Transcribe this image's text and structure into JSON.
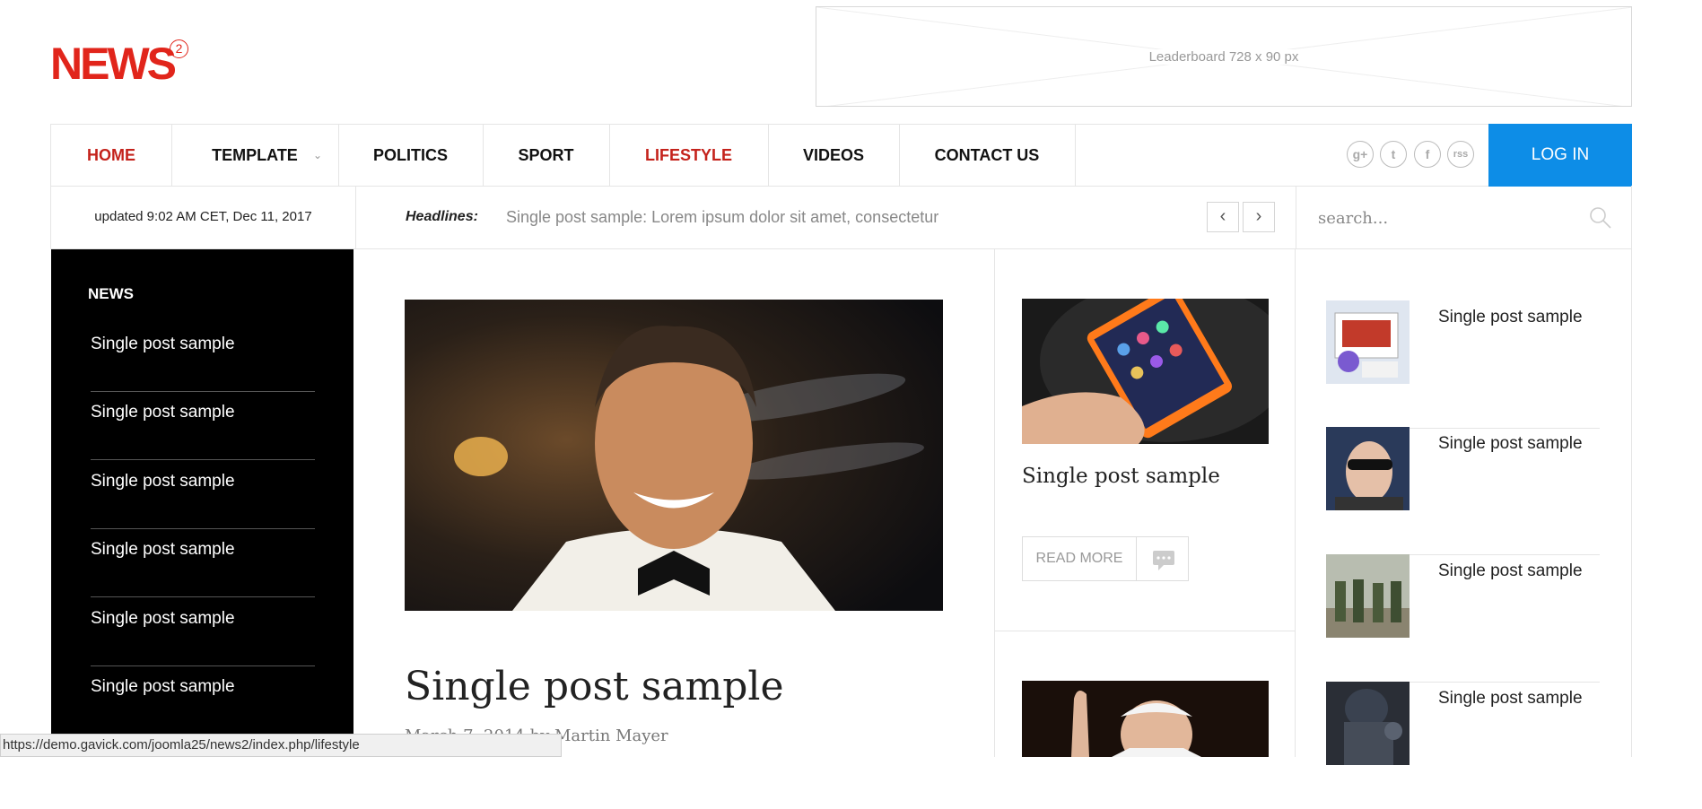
{
  "logo": {
    "text": "NEWS",
    "superscript": "2"
  },
  "leaderboard": {
    "label": "Leaderboard  728 x 90 px"
  },
  "nav": {
    "items": [
      {
        "label": "HOME"
      },
      {
        "label": "TEMPLATE"
      },
      {
        "label": "POLITICS"
      },
      {
        "label": "SPORT"
      },
      {
        "label": "LIFESTYLE"
      },
      {
        "label": "VIDEOS"
      },
      {
        "label": "CONTACT US"
      }
    ],
    "social": [
      "g+",
      "t",
      "f",
      "rss"
    ],
    "login_label": "LOG IN"
  },
  "infobar": {
    "updated": "updated 9:02 AM CET, Dec 11, 2017",
    "headlines_label": "Headlines:",
    "headline": "Single post sample: Lorem ipsum dolor sit amet, consectetur",
    "prev_label": "‹",
    "next_label": "›"
  },
  "search": {
    "placeholder": "search..."
  },
  "news_panel": {
    "title": "NEWS",
    "items": [
      "Single post sample",
      "Single post sample",
      "Single post sample",
      "Single post sample",
      "Single post sample",
      "Single post sample"
    ]
  },
  "main_article": {
    "title": "Single post sample",
    "meta": "March 7, 2014 by Martin Mayer"
  },
  "middle": {
    "title": "Single post sample",
    "read_more": "READ MORE"
  },
  "side_list": [
    "Single post sample",
    "Single post sample",
    "Single post sample",
    "Single post sample"
  ],
  "statusbar": {
    "url": "https://demo.gavick.com/joomla25/news2/index.php/lifestyle"
  },
  "colors": {
    "brand_red": "#e1251b",
    "nav_red": "#c4221b",
    "login_blue": "#0d8de7"
  },
  "icons": [
    "search-icon",
    "comment-icon",
    "google-plus-icon",
    "twitter-icon",
    "facebook-icon",
    "rss-icon",
    "chevron-down-icon"
  ]
}
